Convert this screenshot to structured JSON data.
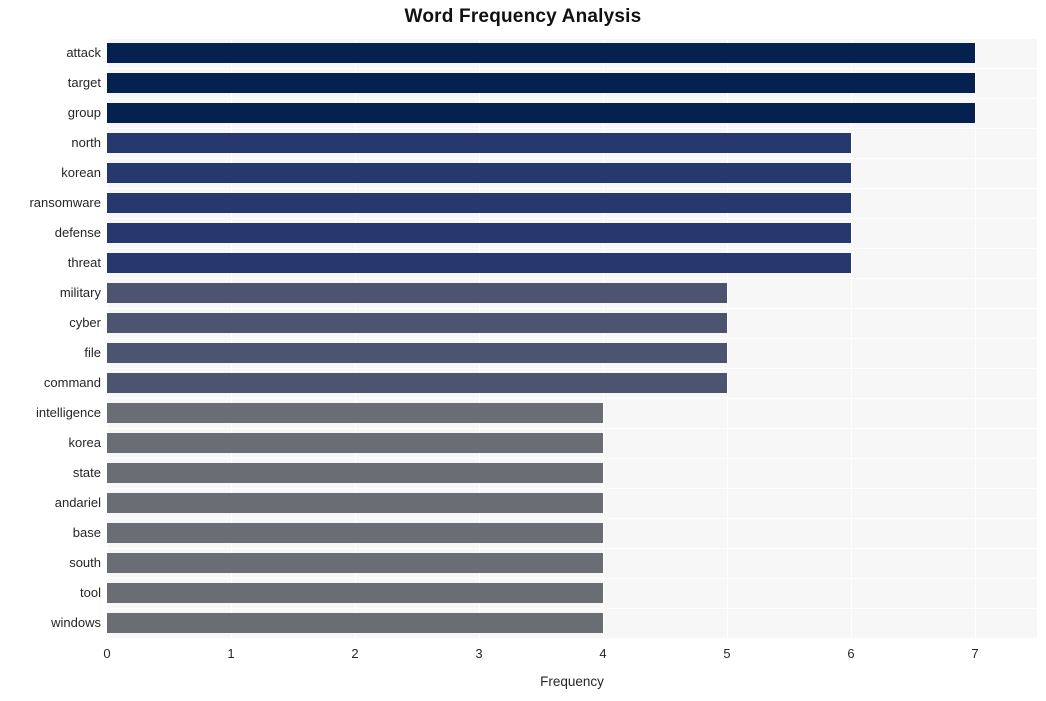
{
  "chart_data": {
    "type": "bar",
    "orientation": "horizontal",
    "title": "Word Frequency Analysis",
    "xlabel": "Frequency",
    "ylabel": "",
    "xlim": [
      0,
      7.5
    ],
    "xticks": [
      0,
      1,
      2,
      3,
      4,
      5,
      6,
      7
    ],
    "xticklabels": [
      "0",
      "1",
      "2",
      "3",
      "4",
      "5",
      "6",
      "7"
    ],
    "grid": true,
    "legend": "none",
    "plot_background": "#f7f7f7",
    "figure_background": "#ffffff",
    "gridline_color": "#ffffff",
    "categories": [
      "attack",
      "target",
      "group",
      "north",
      "korean",
      "ransomware",
      "defense",
      "threat",
      "military",
      "cyber",
      "file",
      "command",
      "intelligence",
      "korea",
      "state",
      "andariel",
      "base",
      "south",
      "tool",
      "windows"
    ],
    "values": [
      7,
      7,
      7,
      6,
      6,
      6,
      6,
      6,
      5,
      5,
      5,
      5,
      4,
      4,
      4,
      4,
      4,
      4,
      4,
      4
    ],
    "bar_colors": [
      "#04214f",
      "#04214f",
      "#04214f",
      "#27386e",
      "#27386e",
      "#27386e",
      "#27386e",
      "#27386e",
      "#4c5470",
      "#4c5470",
      "#4c5470",
      "#4c5470",
      "#6a6d73",
      "#6a6d73",
      "#6a6d73",
      "#6a6d73",
      "#6a6d73",
      "#6a6d73",
      "#6a6d73",
      "#6a6d73"
    ],
    "color_palette": {
      "tier_7": "#04214f",
      "tier_6": "#27386e",
      "tier_5": "#4c5470",
      "tier_4": "#6a6d73"
    }
  }
}
